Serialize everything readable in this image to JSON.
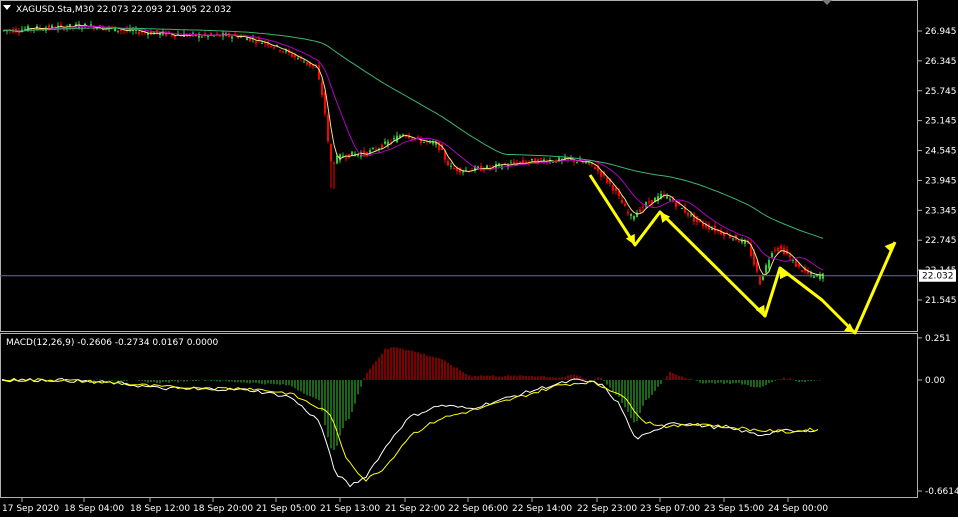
{
  "symbol_header": "XAGUSD.Sta,M30  22.073 22.093 21.905 22.032",
  "macd_header": "MACD(12,26,9) -0.2606 -0.2734 0.0167 0.0000",
  "price_axis": [
    "26.945",
    "26.345",
    "25.745",
    "25.145",
    "24.545",
    "23.945",
    "23.345",
    "22.745",
    "22.145",
    "21.545"
  ],
  "current_price": "22.032",
  "macd_axis": [
    "0.251",
    "0.00",
    "-0.6614"
  ],
  "time_axis": [
    "17 Sep 2020",
    "18 Sep 04:00",
    "18 Sep 12:00",
    "18 Sep 20:00",
    "21 Sep 05:00",
    "21 Sep 13:00",
    "21 Sep 22:00",
    "22 Sep 06:00",
    "22 Sep 14:00",
    "22 Sep 23:00",
    "23 Sep 07:00",
    "23 Sep 15:00",
    "24 Sep 00:00"
  ],
  "colors": {
    "background": "#000000",
    "bull": "#32cd32",
    "bear": "#ff0000",
    "ma_fast": "#f0e68c",
    "ma_mid": "#b000c0",
    "ma_slow": "#3cb371",
    "arrows": "#ffff00",
    "grid": "#b0b0b0",
    "price_line": "#6a6a9a"
  },
  "icons": {
    "menu": "triangle-down-icon"
  },
  "chart_data": {
    "type": "candlestick",
    "title": "XAGUSD.Sta,M30",
    "ohlc_last": {
      "open": 22.073,
      "high": 22.093,
      "low": 21.905,
      "close": 22.032
    },
    "x": [
      "17 Sep 2020",
      "18 Sep 04:00",
      "18 Sep 12:00",
      "18 Sep 20:00",
      "21 Sep 05:00",
      "21 Sep 13:00",
      "21 Sep 22:00",
      "22 Sep 06:00",
      "22 Sep 14:00",
      "22 Sep 23:00",
      "23 Sep 07:00",
      "23 Sep 15:00",
      "24 Sep 00:00"
    ],
    "approx_close": [
      26.9,
      27.0,
      26.9,
      26.8,
      26.1,
      24.4,
      24.7,
      24.1,
      24.4,
      23.7,
      23.5,
      22.6,
      22.0
    ],
    "ylim": [
      21.4,
      27.5
    ],
    "macd": {
      "params": "12,26,9",
      "main": -0.2606,
      "signal": -0.2734,
      "histogram": 0.0167,
      "zero": 0.0,
      "ylim": [
        -0.6614,
        0.251
      ],
      "approx_main": [
        0.02,
        0.0,
        -0.05,
        -0.07,
        -0.15,
        -0.62,
        -0.25,
        -0.05,
        -0.03,
        0.02,
        -0.28,
        -0.22,
        -0.27
      ],
      "approx_signal": [
        0.01,
        0.0,
        -0.03,
        -0.06,
        -0.1,
        -0.55,
        -0.3,
        -0.1,
        -0.04,
        0.0,
        -0.2,
        -0.24,
        -0.26
      ]
    }
  }
}
